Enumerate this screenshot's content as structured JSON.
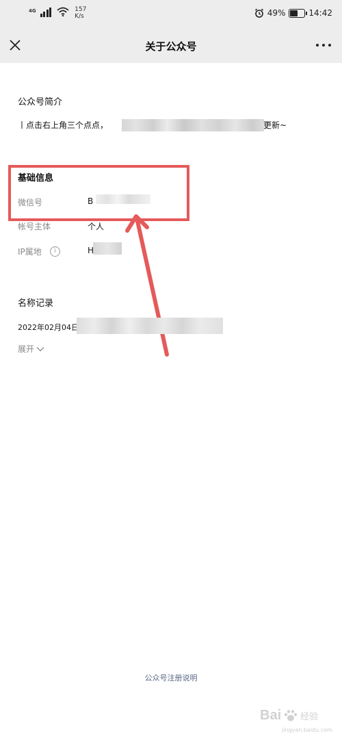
{
  "status_bar": {
    "network_type": "4G",
    "speed_value": "157",
    "speed_unit": "K/s",
    "battery": "49%",
    "battery_level": 0.49,
    "time": "14:42"
  },
  "nav": {
    "title": "关于公众号",
    "close_icon": "close-icon",
    "more_icon": "more-icon"
  },
  "intro": {
    "heading": "公众号简介",
    "text_visible_start": "丨点击右上角三个点点，",
    "text_visible_end": "更新~"
  },
  "basic_info": {
    "heading": "基础信息",
    "wechat_id_label": "微信号",
    "wechat_id_value": "B",
    "subject_label": "帐号主体",
    "subject_value": "个人",
    "ip_label": "IP属地",
    "ip_value": "H",
    "info_icon": "info-icon"
  },
  "name_history": {
    "heading": "名称记录",
    "record_start": "2022年02月04日",
    "expand_label": "展开"
  },
  "footer": {
    "link": "公众号注册说明"
  },
  "watermark": {
    "text": "Bai",
    "sub": "经验",
    "url": "jingyan.baidu.com"
  },
  "colors": {
    "nav_bg": "#ededed",
    "annotation_red": "#e55a5a",
    "footer_link": "#5a6a86"
  }
}
